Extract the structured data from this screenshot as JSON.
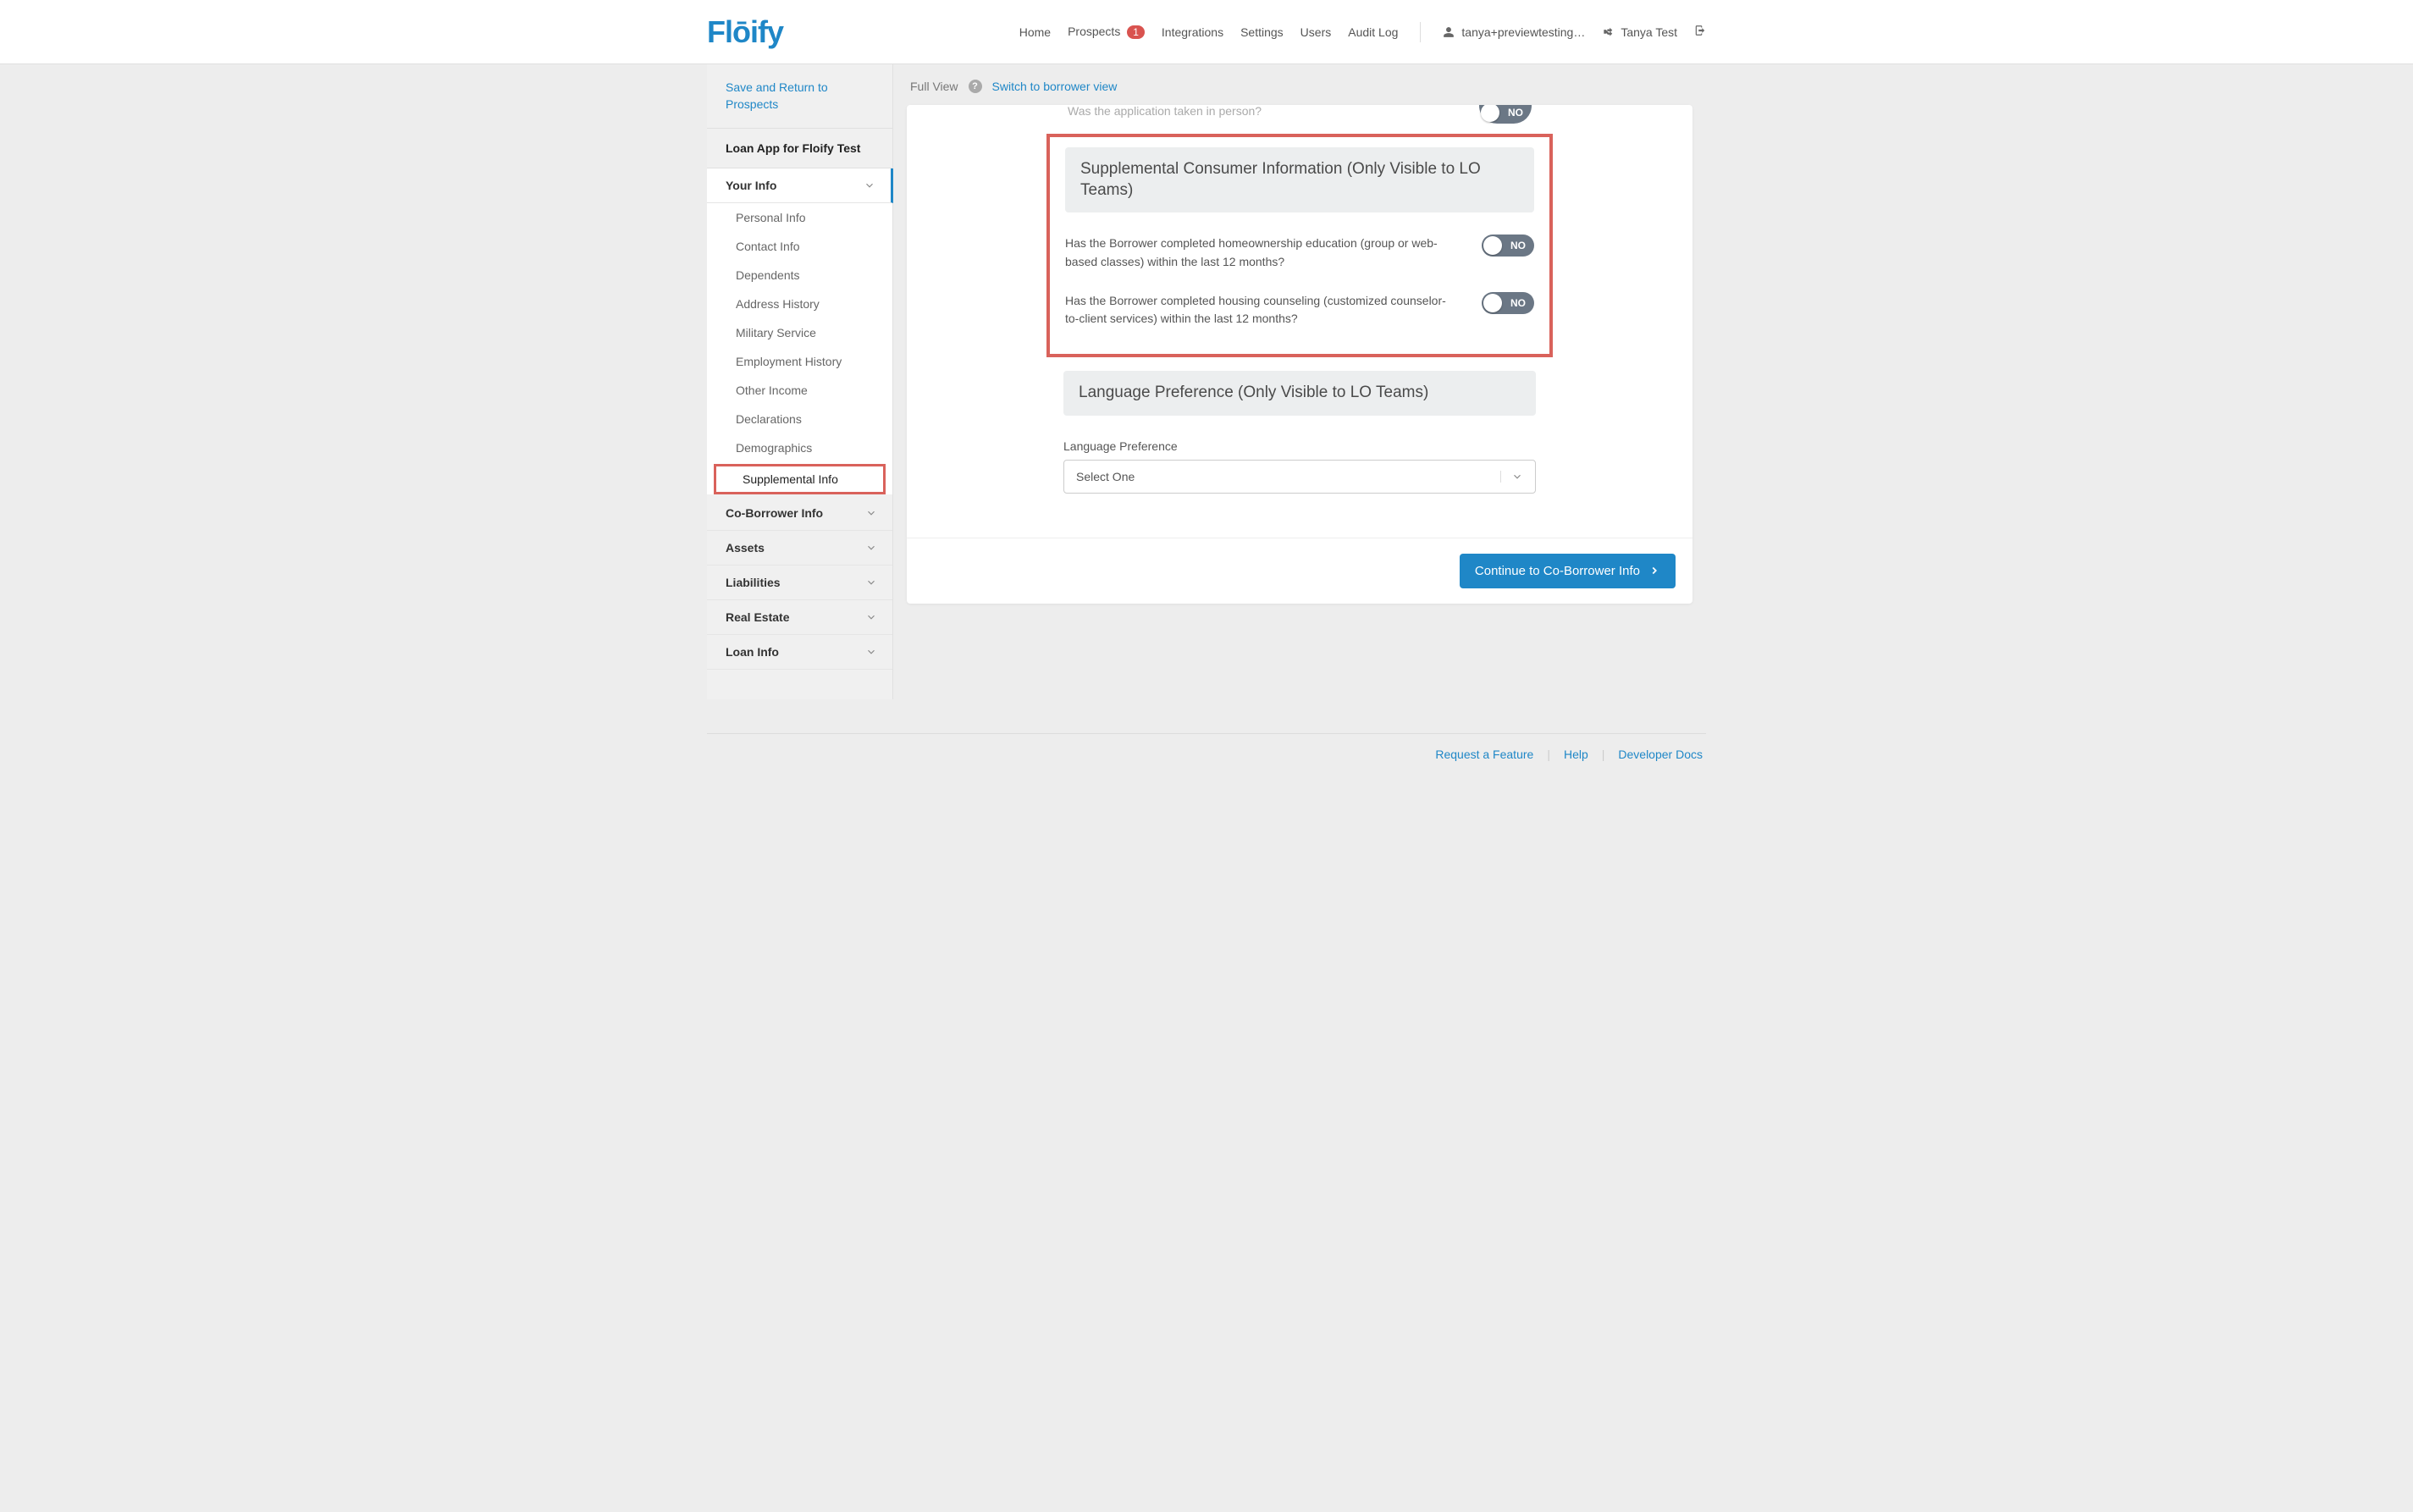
{
  "brand": "Flōify",
  "nav": {
    "home": "Home",
    "prospects": "Prospects",
    "prospects_badge": "1",
    "integrations": "Integrations",
    "settings": "Settings",
    "users": "Users",
    "audit_log": "Audit Log"
  },
  "user": {
    "email": "tanya+previewtesting…",
    "name": "Tanya Test"
  },
  "sidebar": {
    "save_return": "Save and Return to Prospects",
    "app_title": "Loan App for Floify Test",
    "sections": {
      "your_info": "Your Info",
      "co_borrower": "Co-Borrower Info",
      "assets": "Assets",
      "liabilities": "Liabilities",
      "real_estate": "Real Estate",
      "loan_info": "Loan Info"
    },
    "your_info_items": {
      "personal": "Personal Info",
      "contact": "Contact Info",
      "dependents": "Dependents",
      "address": "Address History",
      "military": "Military Service",
      "employment": "Employment History",
      "other_income": "Other Income",
      "declarations": "Declarations",
      "demographics": "Demographics",
      "supplemental": "Supplemental Info"
    }
  },
  "content_header": {
    "full_view": "Full View",
    "switch_link": "Switch to borrower view"
  },
  "partial": {
    "question": "Was the application taken in person?",
    "toggle": "NO"
  },
  "sci": {
    "heading": "Supplemental Consumer Information (Only Visible to LO Teams)",
    "q1": "Has the Borrower completed homeownership education (group or web-based classes) within the last 12 months?",
    "q1_toggle": "NO",
    "q2": "Has the Borrower completed housing counseling (customized counselor-to-client services) within the last 12 months?",
    "q2_toggle": "NO"
  },
  "lang_pref": {
    "heading": "Language Preference (Only Visible to LO Teams)",
    "label": "Language Preference",
    "placeholder": "Select One"
  },
  "continue_btn": "Continue to Co-Borrower Info",
  "footer": {
    "request": "Request a Feature",
    "help": "Help",
    "docs": "Developer Docs"
  }
}
